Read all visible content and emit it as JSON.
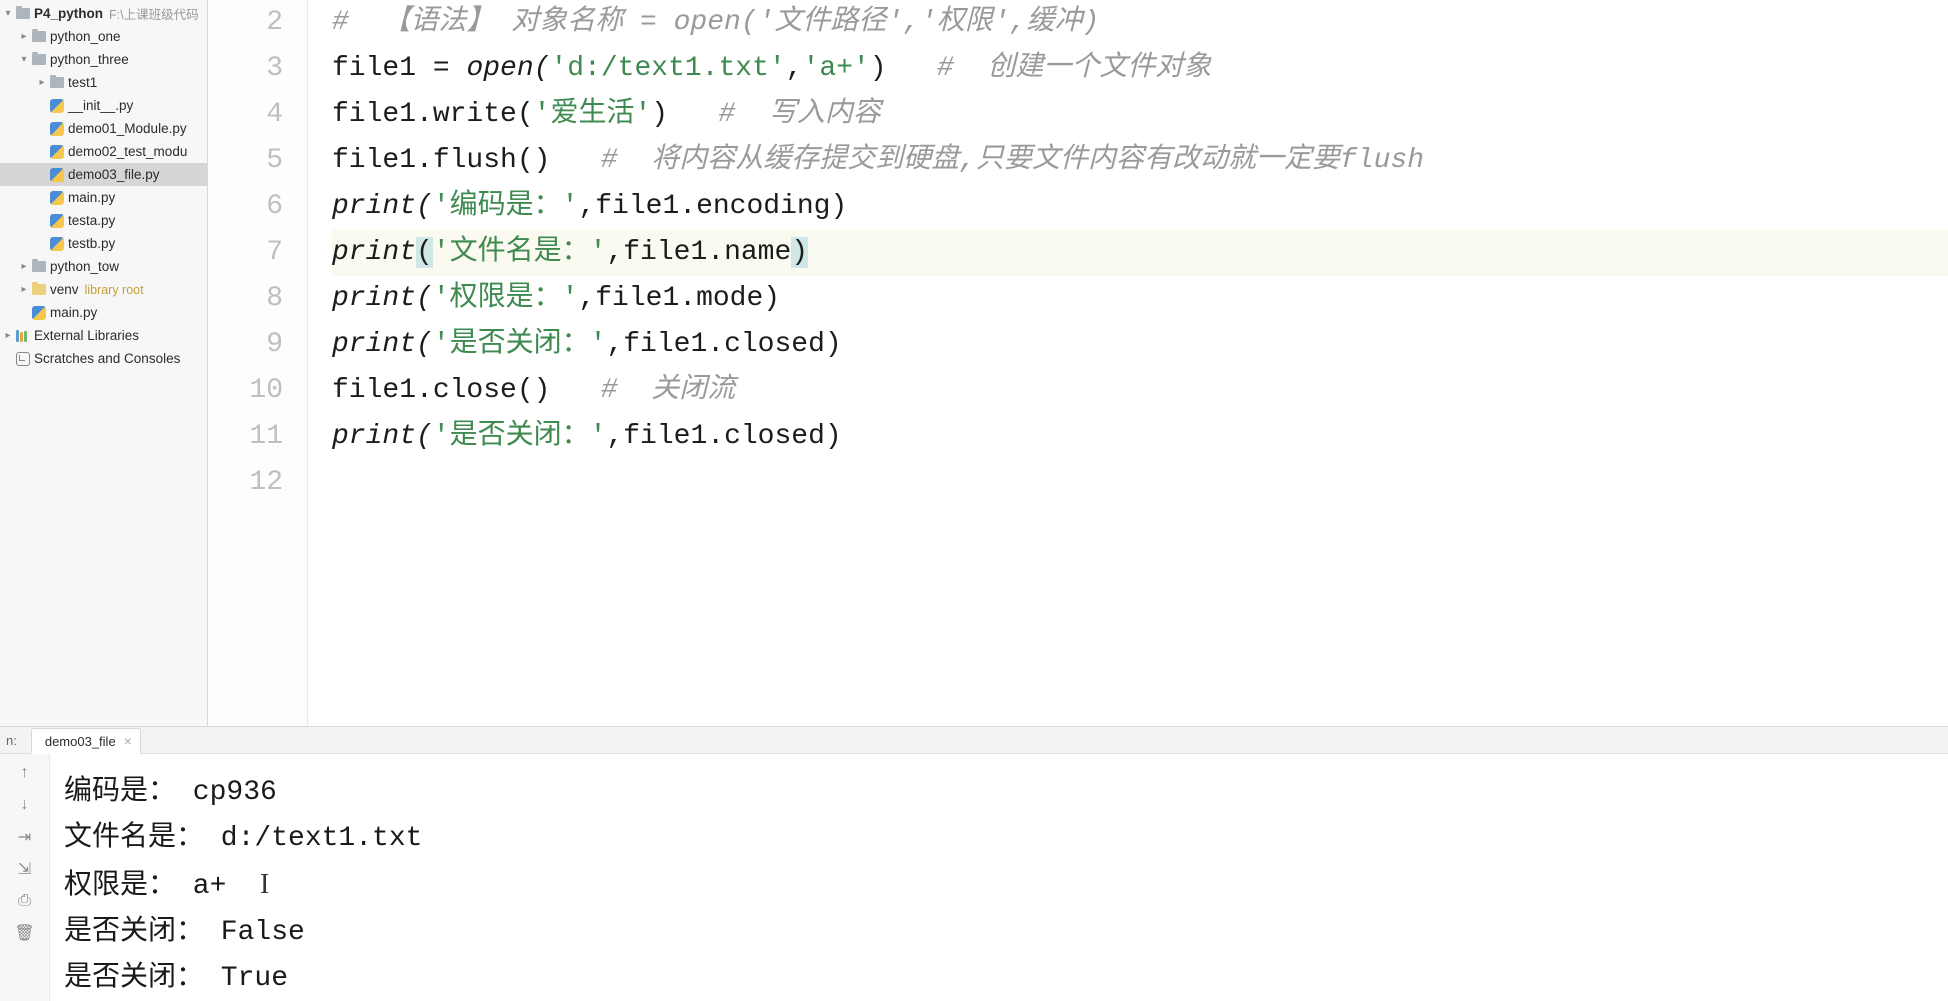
{
  "sidebar": {
    "project_name": "P4_python",
    "project_path": "F:\\上课班级代码",
    "tree": [
      {
        "indent": 1,
        "arrow": "right",
        "icon": "folder",
        "label": "python_one"
      },
      {
        "indent": 1,
        "arrow": "down",
        "icon": "folder",
        "label": "python_three"
      },
      {
        "indent": 2,
        "arrow": "right",
        "icon": "folder",
        "label": "test1"
      },
      {
        "indent": 2,
        "arrow": "",
        "icon": "py",
        "label": "__init__.py"
      },
      {
        "indent": 2,
        "arrow": "",
        "icon": "py",
        "label": "demo01_Module.py"
      },
      {
        "indent": 2,
        "arrow": "",
        "icon": "py",
        "label": "demo02_test_modu"
      },
      {
        "indent": 2,
        "arrow": "",
        "icon": "py",
        "label": "demo03_file.py",
        "selected": true
      },
      {
        "indent": 2,
        "arrow": "",
        "icon": "py",
        "label": "main.py"
      },
      {
        "indent": 2,
        "arrow": "",
        "icon": "py",
        "label": "testa.py"
      },
      {
        "indent": 2,
        "arrow": "",
        "icon": "py",
        "label": "testb.py"
      },
      {
        "indent": 1,
        "arrow": "right",
        "icon": "folder",
        "label": "python_tow"
      },
      {
        "indent": 1,
        "arrow": "right",
        "icon": "venv",
        "label": "venv",
        "hint": "library root"
      },
      {
        "indent": 1,
        "arrow": "",
        "icon": "py",
        "label": "main.py"
      },
      {
        "indent": 0,
        "arrow": "right",
        "icon": "lib",
        "label": "External Libraries"
      },
      {
        "indent": 0,
        "arrow": "",
        "icon": "scratch",
        "label": "Scratches and Consoles"
      }
    ]
  },
  "editor": {
    "gutter_start": 2,
    "gutter_end": 12,
    "current_line_index": 5,
    "lines": [
      {
        "segments": [
          {
            "t": "#  【语法】 对象名称 = open('文件路径','权限',缓冲)",
            "c": "tok-comment"
          }
        ]
      },
      {
        "segments": [
          {
            "t": "file1 ",
            "c": "tok-id"
          },
          {
            "t": "= ",
            "c": "tok-op"
          },
          {
            "t": "open(",
            "c": "tok-builtin"
          },
          {
            "t": "'d:/text1.txt'",
            "c": "tok-str"
          },
          {
            "t": ",",
            "c": "tok-op"
          },
          {
            "t": "'a+'",
            "c": "tok-str"
          },
          {
            "t": ")   ",
            "c": "tok-op"
          },
          {
            "t": "#  创建一个文件对象",
            "c": "tok-comment"
          }
        ]
      },
      {
        "segments": [
          {
            "t": "file1.write(",
            "c": "tok-id"
          },
          {
            "t": "'爱生活'",
            "c": "tok-str"
          },
          {
            "t": ")   ",
            "c": "tok-op"
          },
          {
            "t": "#  写入内容",
            "c": "tok-comment"
          }
        ]
      },
      {
        "segments": [
          {
            "t": "file1.flush()   ",
            "c": "tok-id"
          },
          {
            "t": "#  将内容从缓存提交到硬盘,只要文件内容有改动就一定要flush",
            "c": "tok-comment"
          }
        ]
      },
      {
        "segments": [
          {
            "t": "print(",
            "c": "tok-builtin"
          },
          {
            "t": "'编码是：'",
            "c": "tok-str"
          },
          {
            "t": ",",
            "c": "tok-op"
          },
          {
            "t": "file1.encoding)",
            "c": "tok-id"
          }
        ]
      },
      {
        "segments": [
          {
            "t": "print",
            "c": "tok-builtin"
          },
          {
            "t": "(",
            "c": "tok-op hl-bracket"
          },
          {
            "t": "'文件名是：'",
            "c": "tok-str"
          },
          {
            "t": ",",
            "c": "tok-op"
          },
          {
            "t": "file1.name",
            "c": "tok-id"
          },
          {
            "t": ")",
            "c": "tok-op hl-bracket"
          }
        ]
      },
      {
        "segments": [
          {
            "t": "print(",
            "c": "tok-builtin"
          },
          {
            "t": "'权限是：'",
            "c": "tok-str"
          },
          {
            "t": ",",
            "c": "tok-op"
          },
          {
            "t": "file1.mode)",
            "c": "tok-id"
          }
        ]
      },
      {
        "segments": [
          {
            "t": "print(",
            "c": "tok-builtin"
          },
          {
            "t": "'是否关闭：'",
            "c": "tok-str"
          },
          {
            "t": ",",
            "c": "tok-op"
          },
          {
            "t": "file1.closed)",
            "c": "tok-id"
          }
        ]
      },
      {
        "segments": [
          {
            "t": "file1.close()   ",
            "c": "tok-id"
          },
          {
            "t": "#  关闭流",
            "c": "tok-comment"
          }
        ]
      },
      {
        "segments": [
          {
            "t": "print(",
            "c": "tok-builtin"
          },
          {
            "t": "'是否关闭：'",
            "c": "tok-str"
          },
          {
            "t": ",",
            "c": "tok-op"
          },
          {
            "t": "file1.closed)",
            "c": "tok-id"
          }
        ]
      },
      {
        "segments": [
          {
            "t": "",
            "c": "tok-id"
          }
        ]
      }
    ]
  },
  "run_panel": {
    "label": "n:",
    "tab_name": "demo03_file",
    "output": [
      "编码是： cp936",
      "文件名是： d:/text1.txt",
      "权限是： a+  ",
      "是否关闭： False",
      "是否关闭： True"
    ],
    "tool_buttons": [
      "up",
      "down",
      "wrap",
      "indent",
      "print",
      "trash"
    ]
  }
}
